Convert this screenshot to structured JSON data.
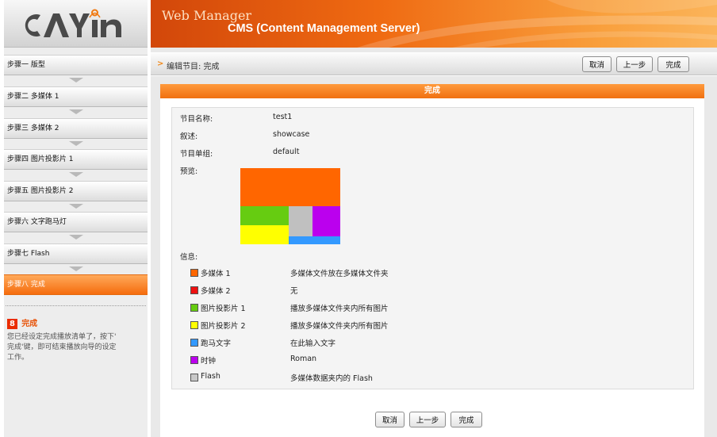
{
  "logo": {
    "text": "CAYIN"
  },
  "sidebar": {
    "steps": [
      {
        "label": "步骤一 版型"
      },
      {
        "label": "步骤二 多媒体 1"
      },
      {
        "label": "步骤三 多媒体 2"
      },
      {
        "label": "步骤四 图片投影片 1"
      },
      {
        "label": "步骤五 图片投影片 2"
      },
      {
        "label": "步骤六 文字跑马灯"
      },
      {
        "label": "步骤七 Flash"
      },
      {
        "label": "步骤八 完成",
        "active": true
      }
    ],
    "done_panel": {
      "badge": "8",
      "title": "完成",
      "desc_1": "您已经设定完成播放清单了，按下'",
      "desc_2": "完成'键，即可结束播放向导的设定",
      "desc_3": "工作。"
    }
  },
  "header": {
    "brand": "Web Manager",
    "product": "CMS (Content Management Server)"
  },
  "titlebar": {
    "crumb_arrow": ">",
    "title": "编辑节目: 完成",
    "cancel_label": "取消",
    "prev_label": "上一步",
    "finish_label": "完成"
  },
  "panel": {
    "header": "完成",
    "fields": {
      "name_label": "节目名称:",
      "name_value": "test1",
      "desc_label": "叙述:",
      "desc_value": "showcase",
      "group_label": "节目单组:",
      "group_value": "default",
      "preview_label": "预览:",
      "info_label": "信息:"
    },
    "preview_colors": {
      "media1": "#ff6600",
      "slide1": "#66cc11",
      "flash": "#c0c0c0",
      "clock": "#bb00ee",
      "slide2": "#ffff00",
      "ticker": "#3399ff"
    },
    "legend": [
      {
        "name": "多媒体 1",
        "color": "#ff6600",
        "value": "多媒体文件放在多媒体文件夹"
      },
      {
        "name": "多媒体 2",
        "color": "#ee1111",
        "value": "无"
      },
      {
        "name": "图片投影片 1",
        "color": "#66cc11",
        "value": "播放多媒体文件夹内所有图片"
      },
      {
        "name": "图片投影片 2",
        "color": "#ffff00",
        "value": "播放多媒体文件夹内所有图片"
      },
      {
        "name": "跑马文字",
        "color": "#3399ff",
        "value": "在此输入文字"
      },
      {
        "name": "时钟",
        "color": "#bb00ee",
        "value": "Roman"
      },
      {
        "name": "Flash",
        "color": "#c8c8c8",
        "value": "多媒体数据夹内的 Flash"
      }
    ],
    "bottom_cancel": "取消",
    "bottom_prev": "上一步",
    "bottom_finish": "完成"
  }
}
